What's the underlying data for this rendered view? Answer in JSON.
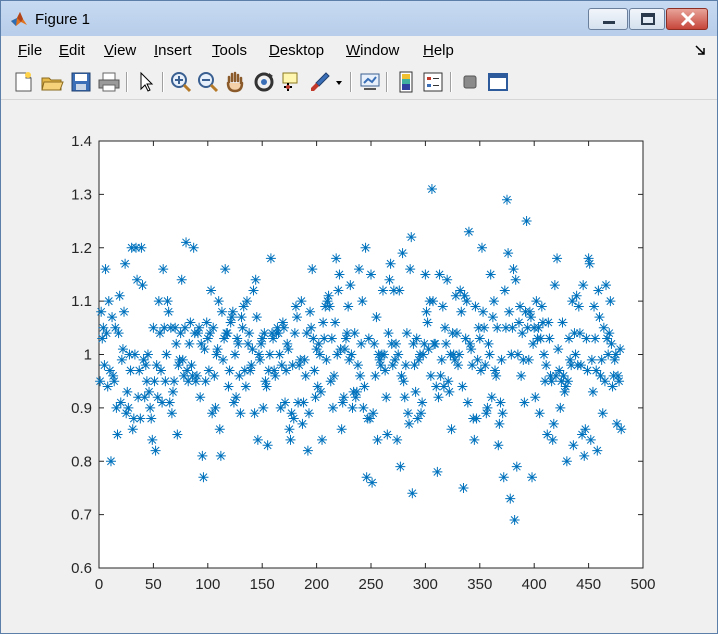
{
  "window": {
    "title": "Figure 1"
  },
  "menu": {
    "items": [
      {
        "id": "file",
        "label": "File"
      },
      {
        "id": "edit",
        "label": "Edit"
      },
      {
        "id": "view",
        "label": "View"
      },
      {
        "id": "insert",
        "label": "Insert"
      },
      {
        "id": "tools",
        "label": "Tools"
      },
      {
        "id": "desktop",
        "label": "Desktop"
      },
      {
        "id": "window",
        "label": "Window"
      },
      {
        "id": "help",
        "label": "Help"
      }
    ]
  },
  "toolbar": {
    "icons": [
      "new-figure-icon",
      "open-file-icon",
      "save-icon",
      "print-icon",
      "pointer-icon",
      "zoom-in-icon",
      "zoom-out-icon",
      "pan-hand-icon",
      "rotate-3d-icon",
      "data-cursor-icon",
      "brush-icon",
      "brush-dropdown-icon",
      "link-plot-icon",
      "colorbar-icon",
      "legend-icon",
      "hide-plot-tools-icon",
      "show-plot-tools-icon"
    ]
  },
  "colors": {
    "marker": "#0072bd",
    "axes": "#262626",
    "background": "#f0f0f0"
  },
  "chart_data": {
    "type": "scatter",
    "marker": "asterisk",
    "title": "",
    "xlabel": "",
    "ylabel": "",
    "xlim": [
      0,
      500
    ],
    "ylim": [
      0.6,
      1.4
    ],
    "xticks": [
      "0",
      "50",
      "100",
      "150",
      "200",
      "250",
      "300",
      "350",
      "400",
      "450",
      "500"
    ],
    "yticks": [
      "0.6",
      "0.7",
      "0.8",
      "0.9",
      "1",
      "1.1",
      "1.2",
      "1.3",
      "1.4"
    ],
    "grid": false,
    "x": [
      1,
      2,
      3,
      4,
      5,
      6,
      7,
      8,
      9,
      10,
      11,
      12,
      13,
      14,
      15,
      16,
      17,
      18,
      19,
      20,
      21,
      22,
      23,
      24,
      25,
      26,
      27,
      28,
      29,
      30,
      31,
      32,
      33,
      34,
      35,
      36,
      37,
      38,
      39,
      40,
      41,
      42,
      43,
      44,
      45,
      46,
      47,
      48,
      49,
      50,
      51,
      52,
      53,
      54,
      55,
      56,
      57,
      58,
      59,
      60,
      61,
      62,
      63,
      64,
      65,
      66,
      67,
      68,
      69,
      70,
      71,
      72,
      73,
      74,
      75,
      76,
      77,
      78,
      79,
      80,
      81,
      82,
      83,
      84,
      85,
      86,
      87,
      88,
      89,
      90,
      91,
      92,
      93,
      94,
      95,
      96,
      97,
      98,
      99,
      100,
      101,
      102,
      103,
      104,
      105,
      106,
      107,
      108,
      109,
      110,
      111,
      112,
      113,
      114,
      115,
      116,
      117,
      118,
      119,
      120,
      121,
      122,
      123,
      124,
      125,
      126,
      127,
      128,
      129,
      130,
      131,
      132,
      133,
      134,
      135,
      136,
      137,
      138,
      139,
      140,
      141,
      142,
      143,
      144,
      145,
      146,
      147,
      148,
      149,
      150,
      151,
      152,
      153,
      154,
      155,
      156,
      157,
      158,
      159,
      160,
      161,
      162,
      163,
      164,
      165,
      166,
      167,
      168,
      169,
      170,
      171,
      172,
      173,
      174,
      175,
      176,
      177,
      178,
      179,
      180,
      181,
      182,
      183,
      184,
      185,
      186,
      187,
      188,
      189,
      190,
      191,
      192,
      193,
      194,
      195,
      196,
      197,
      198,
      199,
      200,
      201,
      202,
      203,
      204,
      205,
      206,
      207,
      208,
      209,
      210,
      211,
      212,
      213,
      214,
      215,
      216,
      217,
      218,
      219,
      220,
      221,
      222,
      223,
      224,
      225,
      226,
      227,
      228,
      229,
      230,
      231,
      232,
      233,
      234,
      235,
      236,
      237,
      238,
      239,
      240,
      241,
      242,
      243,
      244,
      245,
      246,
      247,
      248,
      249,
      250,
      251,
      252,
      253,
      254,
      255,
      256,
      257,
      258,
      259,
      260,
      261,
      262,
      263,
      264,
      265,
      266,
      267,
      268,
      269,
      270,
      271,
      272,
      273,
      274,
      275,
      276,
      277,
      278,
      279,
      280,
      281,
      282,
      283,
      284,
      285,
      286,
      287,
      288,
      289,
      290,
      291,
      292,
      293,
      294,
      295,
      296,
      297,
      298,
      299,
      300,
      301,
      302,
      303,
      304,
      305,
      306,
      307,
      308,
      309,
      310,
      311,
      312,
      313,
      314,
      315,
      316,
      317,
      318,
      319,
      320,
      321,
      322,
      323,
      324,
      325,
      326,
      327,
      328,
      329,
      330,
      331,
      332,
      333,
      334,
      335,
      336,
      337,
      338,
      339,
      340,
      341,
      342,
      343,
      344,
      345,
      346,
      347,
      348,
      349,
      350,
      351,
      352,
      353,
      354,
      355,
      356,
      357,
      358,
      359,
      360,
      361,
      362,
      363,
      364,
      365,
      366,
      367,
      368,
      369,
      370,
      371,
      372,
      373,
      374,
      375,
      376,
      377,
      378,
      379,
      380,
      381,
      382,
      383,
      384,
      385,
      386,
      387,
      388,
      389,
      390,
      391,
      392,
      393,
      394,
      395,
      396,
      397,
      398,
      399,
      400,
      401,
      402,
      403,
      404,
      405,
      406,
      407,
      408,
      409,
      410,
      411,
      412,
      413,
      414,
      415,
      416,
      417,
      418,
      419,
      420,
      421,
      422,
      423,
      424,
      425,
      426,
      427,
      428,
      429,
      430,
      431,
      432,
      433,
      434,
      435,
      436,
      437,
      438,
      439,
      440,
      441,
      442,
      443,
      444,
      445,
      446,
      447,
      448,
      449,
      450,
      451,
      452,
      453,
      454,
      455,
      456,
      457,
      458,
      459,
      460,
      461,
      462,
      463,
      464,
      465,
      466,
      467,
      468,
      469,
      470,
      471,
      472,
      473,
      474,
      475,
      476,
      477,
      478,
      479,
      480,
      481,
      482,
      483,
      484,
      485,
      486,
      487,
      488,
      489,
      490,
      491,
      492,
      493,
      494,
      495,
      496,
      497,
      498,
      499,
      500
    ],
    "y": [
      0.95,
      1.08,
      1.03,
      1.05,
      0.98,
      1.16,
      1.04,
      0.94,
      1.1,
      0.97,
      0.8,
      1.07,
      0.96,
      0.95,
      1.05,
      0.9,
      0.85,
      1.04,
      1.11,
      0.91,
      0.99,
      1.01,
      1.08,
      1.17,
      0.89,
      0.93,
      0.9,
      1.0,
      0.97,
      1.2,
      0.86,
      0.88,
      1.0,
      1.2,
      1.14,
      0.92,
      0.97,
      0.88,
      1.2,
      1.13,
      0.99,
      0.92,
      0.98,
      0.95,
      1.0,
      0.93,
      0.9,
      0.88,
      0.84,
      1.05,
      0.95,
      0.82,
      0.98,
      0.92,
      1.1,
      1.04,
      0.97,
      0.91,
      1.16,
      1.05,
      0.95,
      1.0,
      1.1,
      1.08,
      0.91,
      1.05,
      0.89,
      0.93,
      0.95,
      1.05,
      1.02,
      0.85,
      0.98,
      0.99,
      1.04,
      1.14,
      0.99,
      0.96,
      1.05,
      1.21,
      0.97,
      0.95,
      1.02,
      1.06,
      0.98,
      0.96,
      1.2,
      1.04,
      0.95,
      0.96,
      1.04,
      1.05,
      0.92,
      1.02,
      0.81,
      0.77,
      1.01,
      0.95,
      1.06,
      1.03,
      0.97,
      1.04,
      1.12,
      0.89,
      1.05,
      0.96,
      0.9,
      1.0,
      1.01,
      1.1,
      0.86,
      0.81,
      1.08,
      0.99,
      1.03,
      1.16,
      1.04,
      1.04,
      0.94,
      0.97,
      1.06,
      1.07,
      1.08,
      0.91,
      1.0,
      0.92,
      1.03,
      1.02,
      0.96,
      0.89,
      1.07,
      1.05,
      1.09,
      0.97,
      0.94,
      1.1,
      1.02,
      1.04,
      0.97,
      0.98,
      1.01,
      1.12,
      0.89,
      1.14,
      1.07,
      0.84,
      1.0,
      0.99,
      1.02,
      1.03,
      0.9,
      1.04,
      0.95,
      0.94,
      0.83,
      0.97,
      1.0,
      1.18,
      1.04,
      1.03,
      0.97,
      0.96,
      1.04,
      1.05,
      1.04,
      1.0,
      0.9,
      0.98,
      1.06,
      1.05,
      0.91,
      0.97,
      1.02,
      1.01,
      0.86,
      0.84,
      0.89,
      0.98,
      0.88,
      1.04,
      1.09,
      1.07,
      0.91,
      0.98,
      0.99,
      1.1,
      0.87,
      0.91,
      0.99,
      0.96,
      1.04,
      0.82,
      0.89,
      1.08,
      1.05,
      1.16,
      1.03,
      0.97,
      0.92,
      1.01,
      0.94,
      1.02,
      1.0,
      0.93,
      0.84,
      1.06,
      1.03,
      1.09,
      0.99,
      1.1,
      1.11,
      1.09,
      0.95,
      1.03,
      0.9,
      0.96,
      1.06,
      1.18,
      1.0,
      1.12,
      1.15,
      1.01,
      0.86,
      0.91,
      0.92,
      1.01,
      1.03,
      1.04,
      1.09,
      0.99,
      1.13,
      1.0,
      0.9,
      0.93,
      1.04,
      0.92,
      0.93,
      0.98,
      1.16,
      0.96,
      1.02,
      1.1,
      0.9,
      0.94,
      1.2,
      0.77,
      0.88,
      1.03,
      0.88,
      1.15,
      0.76,
      0.89,
      1.02,
      0.96,
      1.07,
      0.84,
      1.0,
      0.99,
      0.98,
      1.0,
      1.12,
      1.0,
      0.97,
      0.92,
      0.85,
      1.04,
      1.14,
      1.17,
      1.02,
      0.98,
      1.12,
      0.99,
      1.02,
      0.84,
      1.0,
      1.12,
      0.79,
      0.96,
      1.19,
      0.95,
      0.92,
      0.98,
      1.04,
      0.89,
      0.87,
      1.16,
      1.22,
      0.74,
      1.02,
      0.98,
      0.93,
      1.03,
      0.88,
      0.99,
      1.0,
      0.89,
      0.91,
      1.0,
      1.02,
      1.15,
      1.08,
      1.06,
      1.01,
      1.1,
      0.96,
      1.31,
      1.1,
      1.02,
      1.02,
      0.94,
      0.78,
      0.92,
      1.15,
      0.96,
      0.99,
      1.09,
      0.94,
      1.05,
      1.02,
      1.14,
      0.95,
      0.93,
      1.0,
      0.86,
      1.04,
      1.0,
      0.99,
      1.11,
      1.04,
      0.98,
      1.0,
      1.12,
      1.08,
      0.94,
      0.75,
      1.11,
      1.03,
      1.1,
      0.91,
      1.23,
      1.02,
      1.01,
      0.98,
      0.88,
      0.84,
      1.09,
      0.88,
      0.99,
      1.05,
      1.03,
      0.97,
      1.2,
      1.08,
      1.05,
      0.98,
      0.89,
      0.9,
      1.02,
      1.0,
      1.15,
      0.92,
      1.07,
      1.1,
      0.97,
      0.96,
      1.05,
      0.83,
      0.87,
      0.91,
      0.99,
      0.89,
      0.77,
      1.12,
      1.05,
      1.29,
      1.19,
      1.08,
      0.73,
      1.0,
      1.05,
      1.16,
      0.69,
      1.14,
      0.79,
      1.0,
      1.06,
      1.09,
      0.96,
      1.04,
      0.99,
      0.91,
      1.08,
      1.25,
      1.05,
      0.99,
      1.08,
      1.07,
      0.77,
      1.02,
      1.05,
      0.92,
      1.1,
      1.03,
      1.05,
      0.89,
      1.03,
      1.09,
      1.06,
      1.0,
      0.95,
      0.98,
      0.85,
      1.06,
      1.03,
      0.96,
      0.95,
      0.84,
      0.87,
      1.13,
      0.96,
      1.18,
      1.01,
      0.97,
      0.9,
      0.95,
      1.06,
      0.96,
      0.93,
      0.94,
      0.8,
      0.95,
      1.03,
      0.99,
      0.98,
      1.1,
      0.83,
      1.04,
      1.0,
      1.11,
      0.98,
      1.09,
      1.04,
      0.98,
      0.85,
      1.13,
      0.81,
      0.86,
      1.03,
      0.97,
      1.18,
      1.17,
      0.84,
      0.99,
      0.93,
      1.09,
      1.03,
      0.97,
      0.82,
      1.12,
      1.07,
      0.96,
      0.99,
      0.89,
      1.05,
      0.95,
      1.13,
      1.03,
      1.0,
      1.04,
      1.1,
      1.02,
      0.94,
      0.96,
      0.99,
      1.0,
      0.87,
      0.96,
      0.95,
      1.01,
      0.86
    ]
  }
}
